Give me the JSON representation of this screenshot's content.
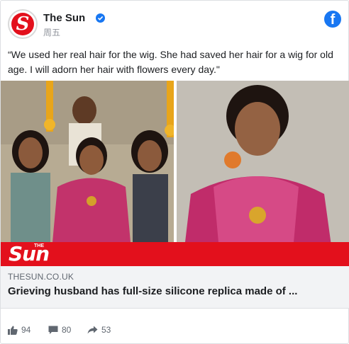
{
  "header": {
    "page_name": "The Sun",
    "post_time": "周五",
    "avatar_letter": "S",
    "facebook_letter": "f"
  },
  "post": {
    "text": "“We used her real hair for the wig. She had saved her hair for a wig for old age. I will adorn her hair with flowers every day.\""
  },
  "image": {
    "overlay_logo": "Sun",
    "overlay_logo_small": "THE"
  },
  "link": {
    "domain": "THESUN.CO.UK",
    "title": "Grieving husband has full-size silicone replica made of ..."
  },
  "stats": {
    "likes": "94",
    "comments": "80",
    "shares": "53"
  },
  "colors": {
    "brand_red": "#e3101c",
    "facebook_blue": "#1877f2"
  }
}
